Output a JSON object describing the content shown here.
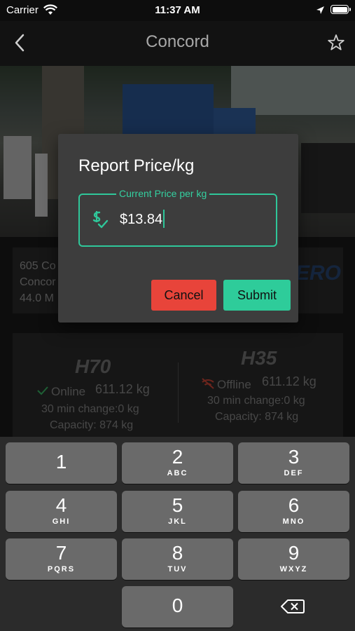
{
  "status_bar": {
    "carrier": "Carrier",
    "time": "11:37 AM",
    "icons": [
      "wifi-icon",
      "location-arrow-icon",
      "battery-icon"
    ]
  },
  "nav": {
    "title": "Concord",
    "back_icon": "chevron-left-icon",
    "favorite_icon": "star-outline-icon"
  },
  "station": {
    "address_lines": [
      "605 Co",
      "Concor",
      "44.0 M"
    ],
    "logo_text": "ERO"
  },
  "dispensers": [
    {
      "grade": "H70",
      "status": "Online",
      "status_color": "#3cbf6a",
      "inventory": "611.12 kg",
      "change": "30 min change:0 kg",
      "capacity": "Capacity: 874 kg"
    },
    {
      "grade": "H35",
      "status": "Offline",
      "status_color": "#d94a3a",
      "inventory": "611.12 kg",
      "change": "30 min change:0 kg",
      "capacity": "Capacity: 874 kg"
    }
  ],
  "dialog": {
    "title": "Report Price/kg",
    "field_label": "Current Price per kg",
    "field_value": "$13.84",
    "cancel_label": "Cancel",
    "submit_label": "Submit",
    "accent_color": "#2fc79a",
    "cancel_color": "#e8443a"
  },
  "keyboard": {
    "keys": [
      {
        "digit": "1",
        "letters": ""
      },
      {
        "digit": "2",
        "letters": "ABC"
      },
      {
        "digit": "3",
        "letters": "DEF"
      },
      {
        "digit": "4",
        "letters": "GHI"
      },
      {
        "digit": "5",
        "letters": "JKL"
      },
      {
        "digit": "6",
        "letters": "MNO"
      },
      {
        "digit": "7",
        "letters": "PQRS"
      },
      {
        "digit": "8",
        "letters": "TUV"
      },
      {
        "digit": "9",
        "letters": "WXYZ"
      },
      {
        "digit": "0",
        "letters": ""
      }
    ],
    "delete_icon": "backspace-icon"
  }
}
